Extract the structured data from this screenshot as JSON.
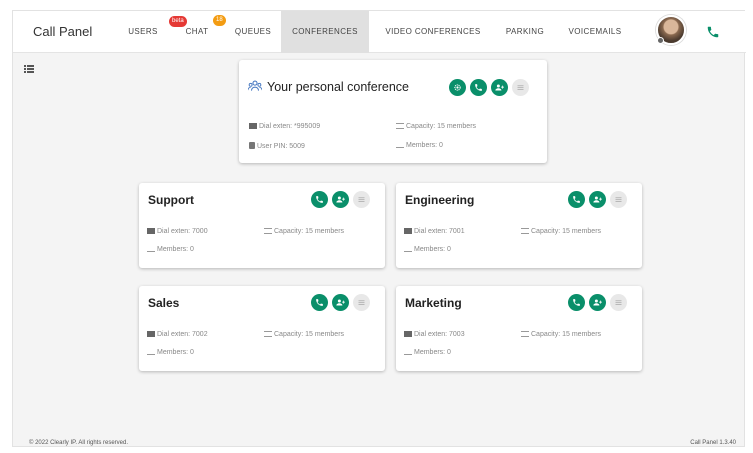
{
  "header": {
    "app_title": "Call Panel",
    "nav": [
      {
        "label": "USERS"
      },
      {
        "label": "CHAT",
        "badge_beta": "beta",
        "badge_count": "18"
      },
      {
        "label": "QUEUES"
      },
      {
        "label": "CONFERENCES",
        "active": true
      },
      {
        "label": "VIDEO CONFERENCES"
      },
      {
        "label": "PARKING"
      },
      {
        "label": "VOICEMAILS"
      }
    ]
  },
  "colors": {
    "accent": "#0a8f6a",
    "badge_red": "#e53935",
    "badge_orange": "#f39c12"
  },
  "personal": {
    "title": "Your personal conference",
    "dial": "Dial exten: *995009",
    "capacity": "Capacity: 15 members",
    "pin": "User PIN: 5009",
    "members": "Members: 0"
  },
  "conferences": [
    {
      "name": "Support",
      "dial": "Dial exten: 7000",
      "capacity": "Capacity: 15 members",
      "members": "Members: 0"
    },
    {
      "name": "Engineering",
      "dial": "Dial exten: 7001",
      "capacity": "Capacity: 15 members",
      "members": "Members: 0"
    },
    {
      "name": "Sales",
      "dial": "Dial exten: 7002",
      "capacity": "Capacity: 15 members",
      "members": "Members: 0"
    },
    {
      "name": "Marketing",
      "dial": "Dial exten: 7003",
      "capacity": "Capacity: 15 members",
      "members": "Members: 0"
    }
  ],
  "footer": {
    "copyright": "© 2022 Clearly IP. All rights reserved.",
    "version": "Call Panel 1.3.40"
  }
}
